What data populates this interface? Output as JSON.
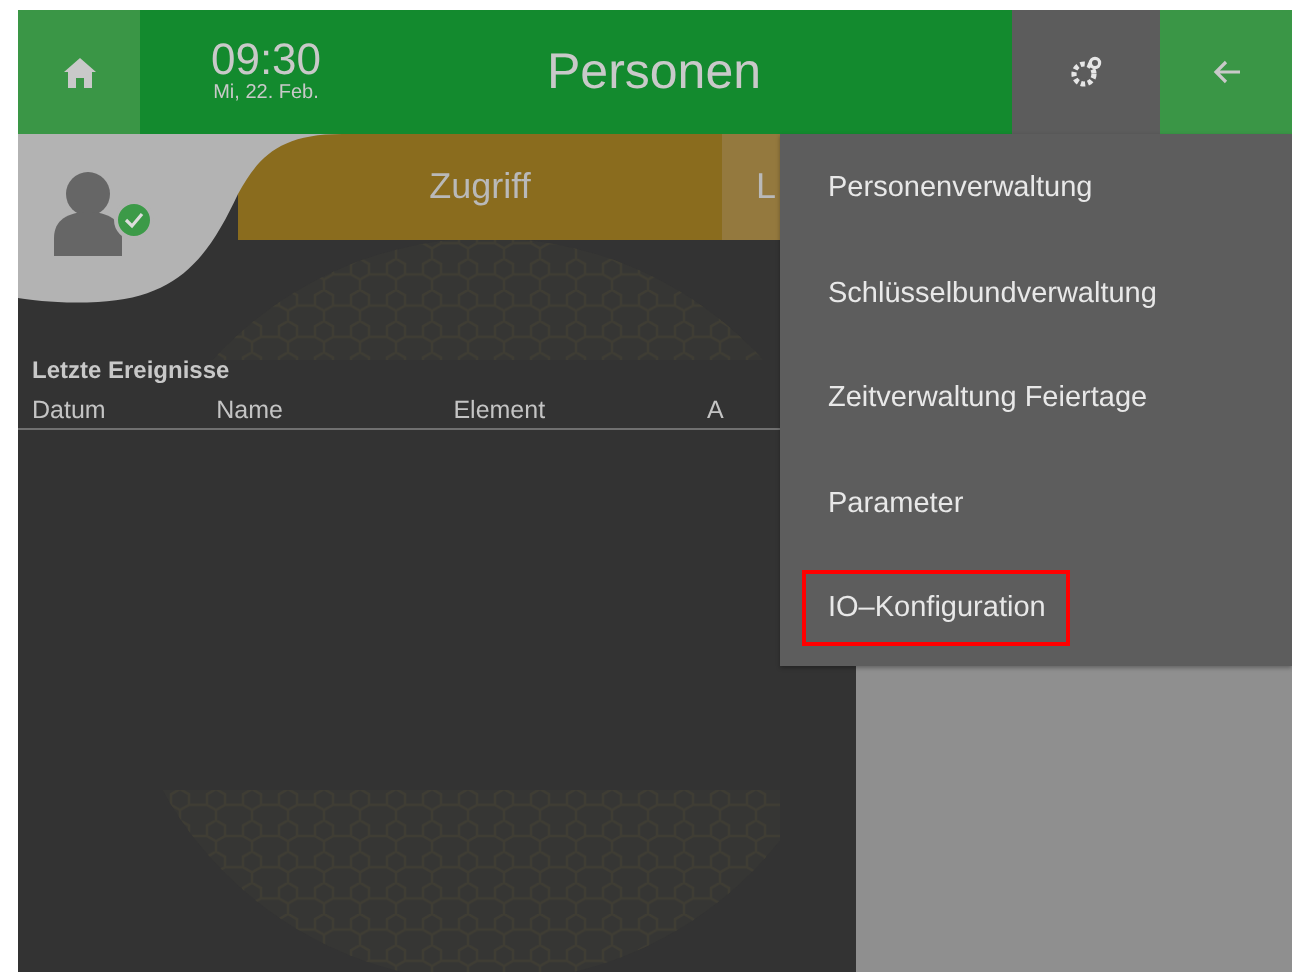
{
  "header": {
    "time": "09:30",
    "date": "Mi, 22. Feb.",
    "title": "Personen",
    "settings_active": true
  },
  "user_status": {
    "verified": true
  },
  "tabs": [
    {
      "label": "Zugriff",
      "selected": true
    },
    {
      "label": "L",
      "selected": false
    }
  ],
  "events": {
    "title": "Letzte Ereignisse",
    "columns": [
      "Datum",
      "Name",
      "Element",
      "A"
    ]
  },
  "menu": {
    "items": [
      {
        "label": "Personenverwaltung",
        "highlighted": false
      },
      {
        "label": "Schlüsselbundverwaltung",
        "highlighted": false
      },
      {
        "label": "Zeitverwaltung Feiertage",
        "highlighted": false
      },
      {
        "label": "Parameter",
        "highlighted": false
      },
      {
        "label": "IO–Konfiguration",
        "highlighted": true
      }
    ]
  }
}
